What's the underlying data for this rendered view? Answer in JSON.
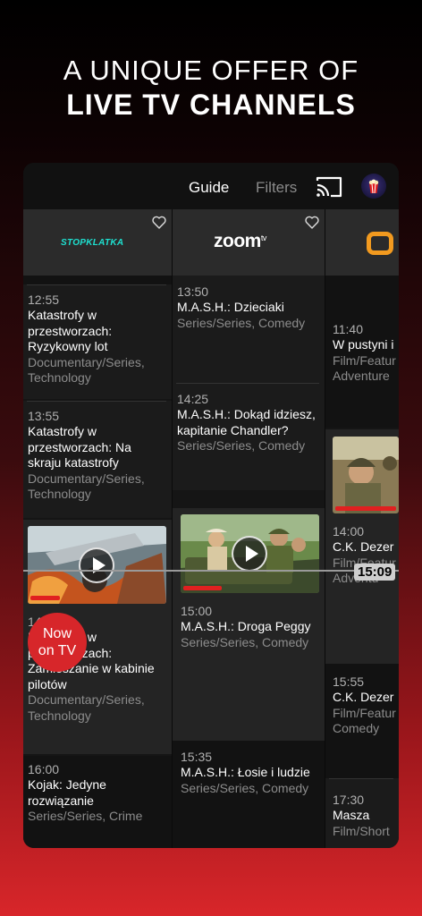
{
  "headline": {
    "line1": "A UNIQUE OFFER OF",
    "line2": "LIVE TV CHANNELS"
  },
  "topbar": {
    "guide": "Guide",
    "filters": "Filters"
  },
  "colors": {
    "accent": "#e02020",
    "stopklatka": "#1ee0d0",
    "channel3": "#f29a1f"
  },
  "channels": [
    {
      "logo": "STOPKLATKA",
      "programs": [
        {
          "time": "12:55",
          "title": "Katastrofy w przestworzach: Ryzykowny lot",
          "genre": "Documentary/Series, Technology"
        },
        {
          "time": "13:55",
          "title": "Katastrofy w przestworzach: Na skraju katastrofy",
          "genre": "Documentary/Series, Technology"
        },
        {
          "time": "14:55",
          "title": "Katastrofy w przestworzach: Zamieszanie w kabinie pilotów",
          "genre": "Documentary/Series, Technology",
          "progress": 0.22
        },
        {
          "time": "16:00",
          "title": "Kojak: Jedyne rozwiązanie",
          "genre": "Series/Series, Crime"
        }
      ]
    },
    {
      "logo": "zoom",
      "logo_sup": "tv",
      "programs": [
        {
          "time": "13:50",
          "title": "M.A.S.H.: Dzieciaki",
          "genre": "Series/Series, Comedy"
        },
        {
          "time": "14:25",
          "title": "M.A.S.H.: Dokąd idziesz, kapitanie Chandler?",
          "genre": "Series/Series, Comedy"
        },
        {
          "time": "15:00",
          "title": "M.A.S.H.: Droga Peggy",
          "genre": "Series/Series, Comedy",
          "progress": 0.29
        },
        {
          "time": "15:35",
          "title": "M.A.S.H.: Łosie i ludzie",
          "genre": "Series/Series, Comedy"
        }
      ]
    },
    {
      "logo": "ring-logo",
      "programs": [
        {
          "time": "11:40",
          "title": "W pustyni i",
          "genre1": "Film/Featur",
          "genre2": "Adventure"
        },
        {
          "time": "14:00",
          "title": "C.K. Dezer",
          "genre1": "Film/Featur",
          "genre2": "Adventu",
          "progress": 0.85
        },
        {
          "time": "15:55",
          "title": "C.K. Dezer",
          "genre1": "Film/Featur",
          "genre2": "Comedy"
        },
        {
          "time": "17:30",
          "title": "Masza",
          "genre1": "Film/Short"
        }
      ]
    }
  ],
  "now": {
    "time": "15:09",
    "button": [
      "Now",
      "on TV"
    ]
  },
  "icons": [
    "cast-icon",
    "profile-avatar-icon",
    "heart-icon",
    "play-icon"
  ]
}
